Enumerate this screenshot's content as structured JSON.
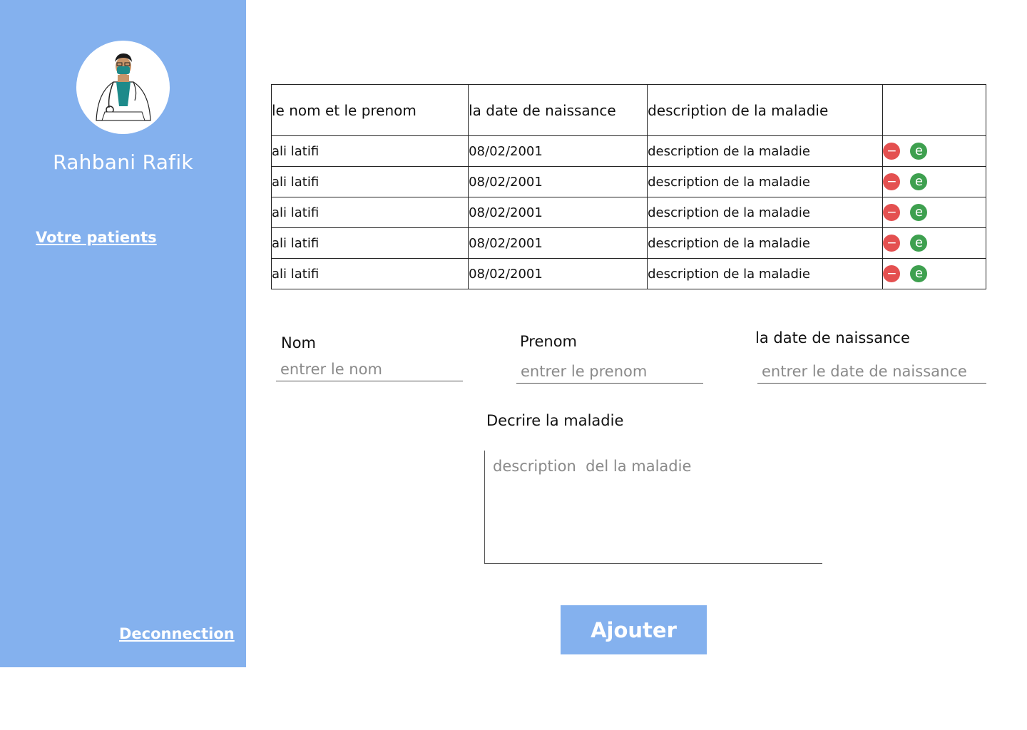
{
  "sidebar": {
    "doctor_name": "Rahbani Rafik",
    "nav_patients": "Votre patients",
    "nav_logout": "Deconnection",
    "background_color": "#84b1ee",
    "avatar_icon": "doctor-avatar-icon"
  },
  "table": {
    "headers": [
      "le nom et le prenom",
      "la date de naissance",
      "description de la maladie",
      ""
    ],
    "rows": [
      {
        "name": "ali latifi",
        "birthdate": "08/02/2001",
        "description": "description de la maladie"
      },
      {
        "name": "ali latifi",
        "birthdate": "08/02/2001",
        "description": "description de la maladie"
      },
      {
        "name": "ali latifi",
        "birthdate": "08/02/2001",
        "description": "description de la maladie"
      },
      {
        "name": "ali latifi",
        "birthdate": "08/02/2001",
        "description": "description de la maladie"
      },
      {
        "name": "ali latifi",
        "birthdate": "08/02/2001",
        "description": "description de la maladie"
      }
    ],
    "delete_icon_glyph": "−",
    "edit_icon_glyph": "e",
    "delete_color": "#e45050",
    "edit_color": "#3ea04f"
  },
  "form": {
    "nom_label": "Nom",
    "nom_placeholder": "entrer le nom",
    "prenom_label": "Prenom",
    "prenom_placeholder": "entrer le prenom",
    "date_label": "la date de naissance",
    "date_placeholder": "entrer le date de naissance",
    "description_label": "Decrire la maladie",
    "description_placeholder": "description  del la maladie",
    "submit_label": "Ajouter"
  }
}
